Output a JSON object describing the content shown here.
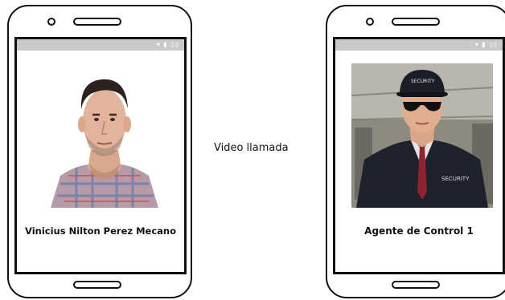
{
  "left_phone": {
    "caption": "Vinicius Nilton Perez Mecano",
    "status_icons": "▾ ▮ ▯▯"
  },
  "right_phone": {
    "caption": "Agente de Control 1",
    "status_icons": "▾ ▮ ▯▯",
    "jacket_text": "SECURITY",
    "cap_text": "SECURITY"
  },
  "center_label": "Video llamada"
}
